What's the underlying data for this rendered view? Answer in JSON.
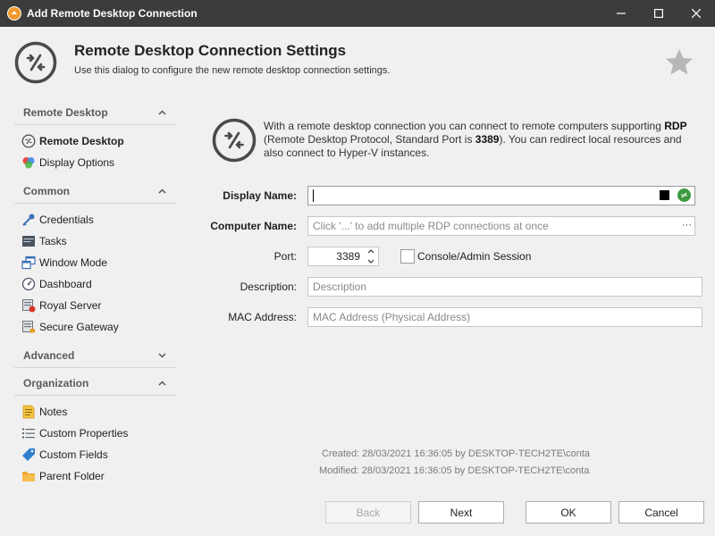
{
  "window": {
    "title": "Add Remote Desktop Connection"
  },
  "header": {
    "title": "Remote Desktop Connection Settings",
    "subtitle": "Use this dialog to configure the new remote desktop connection settings."
  },
  "sidebar": {
    "groups": [
      {
        "label": "Remote Desktop",
        "expanded": true,
        "items": [
          {
            "label": "Remote Desktop",
            "icon": "remote-desktop-icon",
            "selected": true
          },
          {
            "label": "Display Options",
            "icon": "display-options-icon"
          }
        ]
      },
      {
        "label": "Common",
        "expanded": true,
        "items": [
          {
            "label": "Credentials",
            "icon": "key-icon"
          },
          {
            "label": "Tasks",
            "icon": "tasks-icon"
          },
          {
            "label": "Window Mode",
            "icon": "window-mode-icon"
          },
          {
            "label": "Dashboard",
            "icon": "dashboard-icon"
          },
          {
            "label": "Royal Server",
            "icon": "royal-server-icon"
          },
          {
            "label": "Secure Gateway",
            "icon": "secure-gateway-icon"
          }
        ]
      },
      {
        "label": "Advanced",
        "expanded": false,
        "items": []
      },
      {
        "label": "Organization",
        "expanded": true,
        "items": [
          {
            "label": "Notes",
            "icon": "notes-icon"
          },
          {
            "label": "Custom Properties",
            "icon": "custom-properties-icon"
          },
          {
            "label": "Custom Fields",
            "icon": "custom-fields-icon"
          },
          {
            "label": "Parent Folder",
            "icon": "folder-icon"
          }
        ]
      }
    ]
  },
  "info": {
    "text_before_rdp": "With a remote desktop connection you can connect to remote computers supporting ",
    "rdp": "RDP",
    "text_before_port": " (Remote Desktop Protocol, Standard Port is ",
    "port": "3389",
    "text_after_port": "). You can redirect local resources and also connect to Hyper-V instances."
  },
  "form": {
    "display_name": {
      "label": "Display Name:",
      "value": ""
    },
    "computer_name": {
      "label": "Computer Name:",
      "placeholder": "Click '...' to add multiple RDP connections at once",
      "ellipsis": "···"
    },
    "port": {
      "label": "Port:",
      "value": "3389"
    },
    "console_session": {
      "label": "Console/Admin Session",
      "checked": false
    },
    "description": {
      "label": "Description:",
      "placeholder": "Description"
    },
    "mac_address": {
      "label": "MAC Address:",
      "placeholder": "MAC Address (Physical Address)"
    }
  },
  "meta": {
    "created": "Created: 28/03/2021 16:36:05 by DESKTOP-TECH2TE\\conta",
    "modified": "Modified: 28/03/2021 16:36:05 by DESKTOP-TECH2TE\\conta"
  },
  "buttons": {
    "back": "Back",
    "next": "Next",
    "ok": "OK",
    "cancel": "Cancel"
  },
  "colors": {
    "titlebar": "#3c3c3c",
    "accent_green": "#3c9a3e",
    "app_icon": "#f29a2e"
  }
}
